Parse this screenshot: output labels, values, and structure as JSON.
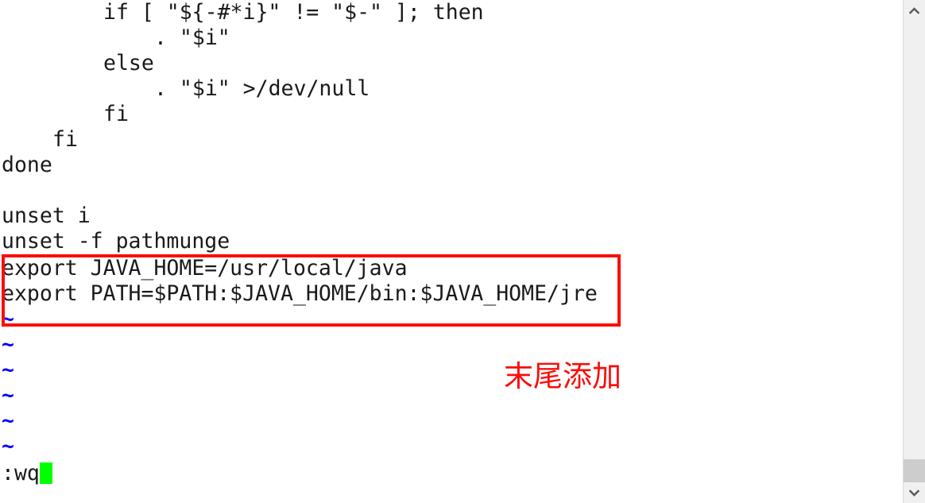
{
  "editor": {
    "name": "vim-editor",
    "background_color": "#ffffff",
    "text_color": "#1a1a1a",
    "tilde_color": "#0000ff",
    "cursor_color": "#00ff00",
    "lines": [
      {
        "indent": 8,
        "text": "if [ \"${-#*i}\" != \"$-\" ]; then"
      },
      {
        "indent": 12,
        "text": ". \"$i\""
      },
      {
        "indent": 8,
        "text": "else"
      },
      {
        "indent": 12,
        "text": ". \"$i\" >/dev/null"
      },
      {
        "indent": 8,
        "text": "fi"
      },
      {
        "indent": 4,
        "text": "fi"
      },
      {
        "indent": 0,
        "text": "done"
      },
      {
        "indent": 0,
        "text": ""
      },
      {
        "indent": 0,
        "text": "unset i"
      },
      {
        "indent": 0,
        "text": "unset -f pathmunge"
      },
      {
        "indent": 0,
        "text": "export JAVA_HOME=/usr/local/java"
      },
      {
        "indent": 0,
        "text": "export PATH=$PATH:$JAVA_HOME/bin:$JAVA_HOME/jre"
      }
    ],
    "empty_markers": [
      "~",
      "~",
      "~",
      "~",
      "~",
      "~"
    ],
    "command_line": {
      "text": ":wq",
      "cursor": "block"
    }
  },
  "annotations": {
    "highlight_box": {
      "color": "#fb0d09",
      "targets": "export JAVA_HOME / export PATH lines"
    },
    "note": {
      "text": "末尾添加",
      "color": "#fb0d09"
    }
  },
  "scrollbar": {
    "up_arrow": "chevron-up-icon",
    "down_arrow": "chevron-down-icon",
    "thumb_color": "#cdcdcd",
    "track_color": "#f0f0f0"
  }
}
